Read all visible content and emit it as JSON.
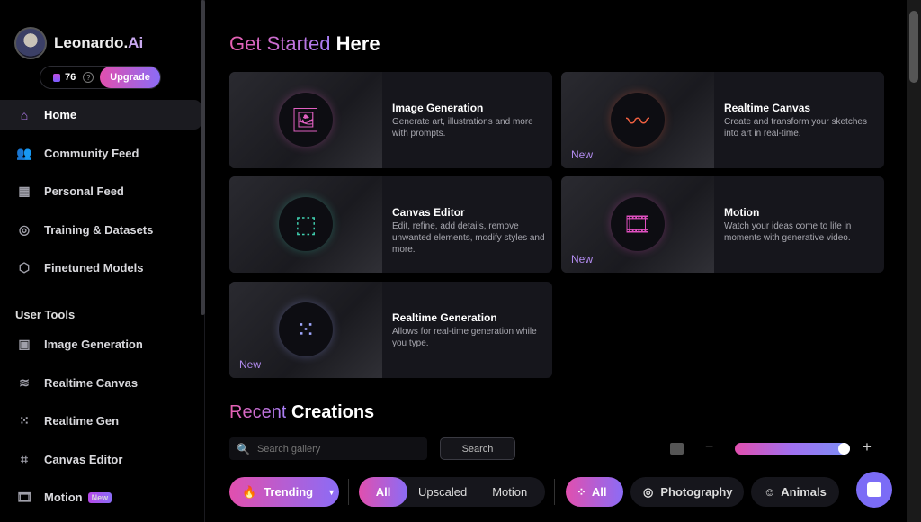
{
  "brand": {
    "name": "Leonardo.",
    "suffix": "Ai",
    "credits": "76",
    "upgrade": "Upgrade"
  },
  "sidebar": {
    "items": [
      {
        "label": "Home",
        "icon": "home-icon",
        "glyph": "⌂"
      },
      {
        "label": "Community Feed",
        "icon": "community-icon",
        "glyph": "👥"
      },
      {
        "label": "Personal Feed",
        "icon": "grid-icon",
        "glyph": "▦"
      },
      {
        "label": "Training & Datasets",
        "icon": "training-icon",
        "glyph": "◎"
      },
      {
        "label": "Finetuned Models",
        "icon": "cube-icon",
        "glyph": "⬡"
      }
    ],
    "section": "User Tools",
    "tools": [
      {
        "label": "Image Generation",
        "icon": "image-icon",
        "glyph": "▣"
      },
      {
        "label": "Realtime Canvas",
        "icon": "brush-icon",
        "glyph": "≋"
      },
      {
        "label": "Realtime Gen",
        "icon": "dots-grid-icon",
        "glyph": "⁙"
      },
      {
        "label": "Canvas Editor",
        "icon": "crop-icon",
        "glyph": "⌗"
      },
      {
        "label": "Motion",
        "icon": "film-icon",
        "glyph": "🎞",
        "badge": "New"
      }
    ]
  },
  "main": {
    "title_a": "Get Started",
    "title_b": "Here",
    "cards": [
      {
        "title": "Image Generation",
        "desc": "Generate art, illustrations and more with prompts.",
        "glyph": "🖼",
        "color": "#e060c0"
      },
      {
        "title": "Realtime Canvas",
        "desc": "Create and transform your sketches into art in real-time.",
        "glyph": "〰",
        "color": "#f06040",
        "badge": "New"
      },
      {
        "title": "Canvas Editor",
        "desc": "Edit, refine, add details, remove unwanted elements, modify styles and more.",
        "glyph": "⬚",
        "color": "#40d0b0"
      },
      {
        "title": "Motion",
        "desc": "Watch your ideas come to life in moments with generative video.",
        "glyph": "🎞",
        "color": "#e050c0",
        "badge": "New"
      },
      {
        "title": "Realtime Generation",
        "desc": "Allows for real-time generation while you type.",
        "glyph": "⁙",
        "color": "#a0a8ff",
        "badge": "New"
      }
    ],
    "recent_a": "Recent",
    "recent_b": "Creations",
    "search_placeholder": "Search gallery",
    "search_button": "Search",
    "filters": {
      "trending": "Trending",
      "all": "All",
      "upscaled": "Upscaled",
      "motion": "Motion",
      "all2": "All",
      "photography": "Photography",
      "animals": "Animals"
    }
  }
}
